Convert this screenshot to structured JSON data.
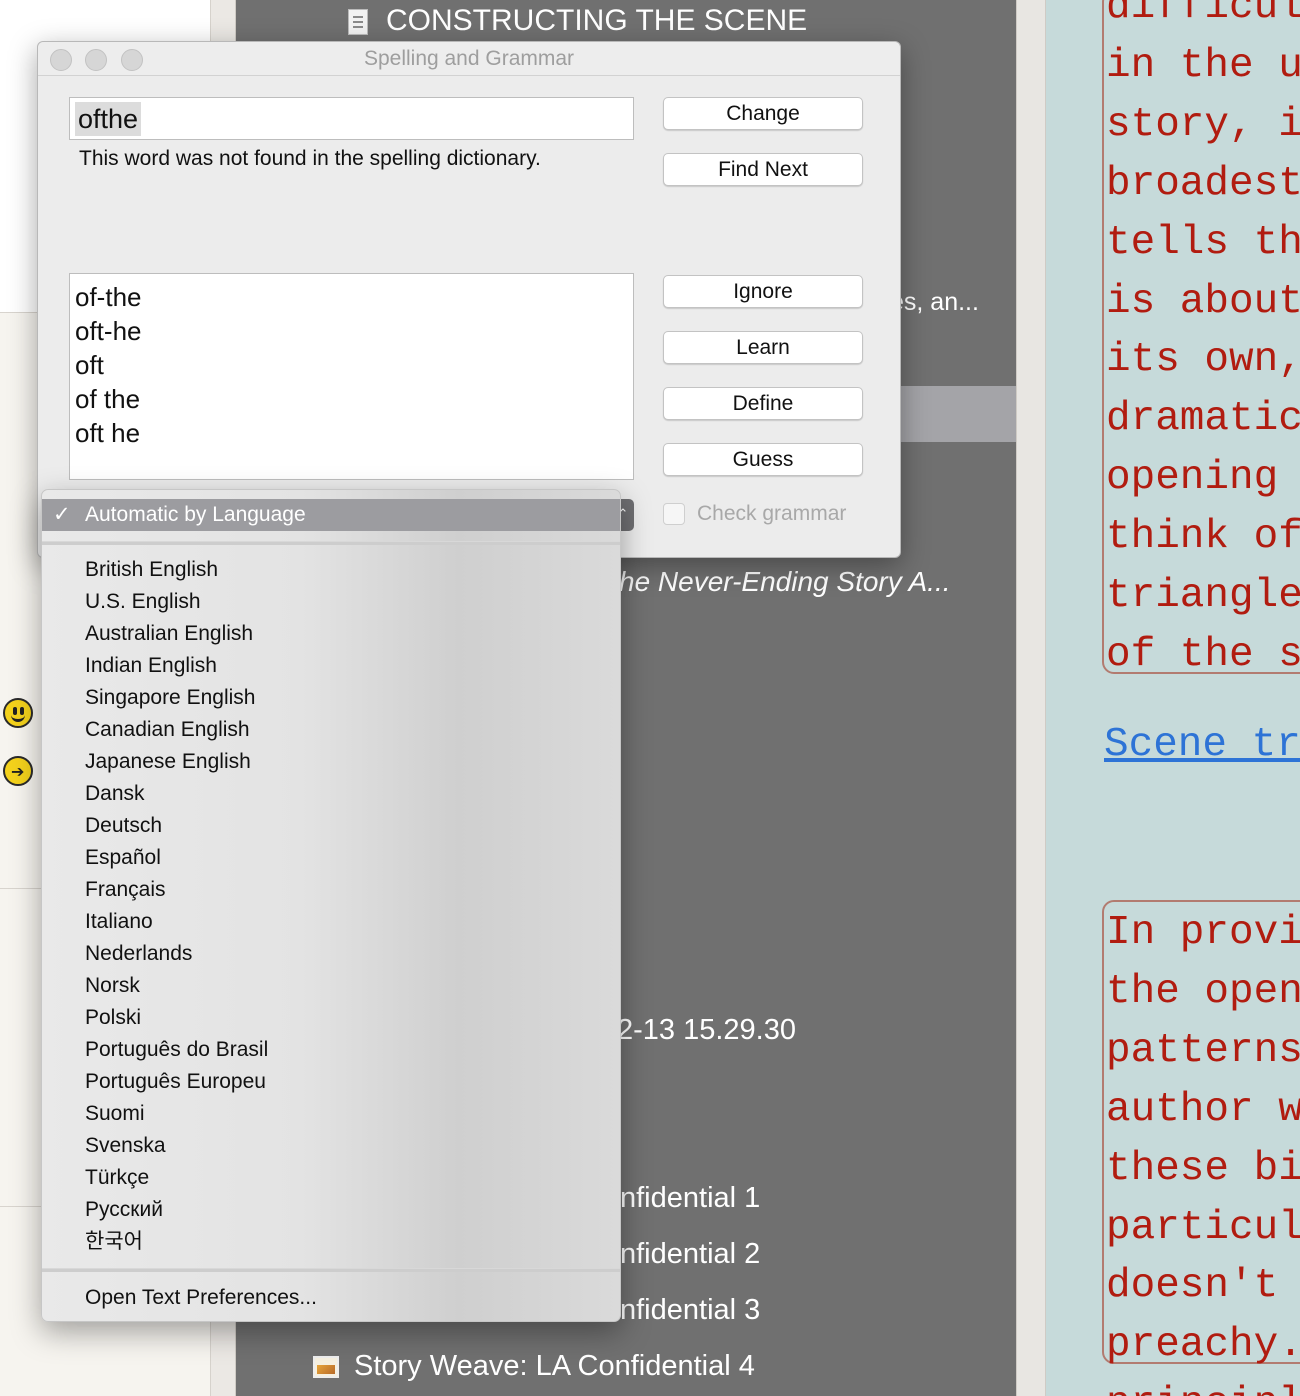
{
  "window": {
    "title": "Spelling and Grammar",
    "misspelled_word": "ofthe",
    "message": "This word was not found in the spelling dictionary.",
    "buttons": {
      "change": "Change",
      "find_next": "Find Next",
      "ignore": "Ignore",
      "learn": "Learn",
      "define": "Define",
      "guess": "Guess"
    },
    "check_grammar_label": "Check grammar",
    "guesses": [
      "of-the",
      "oft-he",
      "oft",
      "of the",
      "oft he"
    ]
  },
  "language_menu": {
    "selected": "Automatic by Language",
    "checkmark": "✓",
    "languages": [
      "British English",
      "U.S. English",
      "Australian English",
      "Indian English",
      "Singapore English",
      "Canadian English",
      "Japanese English",
      "Dansk",
      "Deutsch",
      "Español",
      "Français",
      "Italiano",
      "Nederlands",
      "Norsk",
      "Polski",
      "Português do Brasil",
      "Português Europeu",
      "Suomi",
      "Svenska",
      "Türkçe",
      "Русский",
      "한국어"
    ],
    "open_prefs": "Open Text Preferences..."
  },
  "binder": {
    "title": "CONSTRUCTING THE SCENE",
    "partial_1": "es, an...",
    "partial_2": "he Never-Ending Story  A...",
    "partial_3": "2-13 15.29.30",
    "partial_4": "nfidential 1",
    "partial_5": "nfidential 2",
    "partial_6": "nfidential 3",
    "item_full": "Story Weave: LA Confidential 4"
  },
  "editor": {
    "lines_block_1": [
      "difficul",
      "in the u",
      "story, i",
      "broadest",
      "tells th",
      "is about",
      "its own,",
      "dramatic",
      "opening ",
      "think of",
      "triangle",
      "of the s"
    ],
    "link": "Scene tr",
    "lines_block_2": [
      "In provi",
      "the open",
      "patterns",
      "author w",
      "these bi",
      "particul",
      "doesn't ",
      "preachy.",
      "principl"
    ]
  },
  "icons": {
    "emoji_1": "smiley-face-icon",
    "emoji_2": "arrow-right-circle-icon",
    "doc": "document-icon",
    "image": "image-icon"
  },
  "colors": {
    "binder_bg": "#707070",
    "editor_bg": "#c6dada",
    "editor_text": "#b11c10",
    "link": "#2d73d6",
    "menu_highlight": "#9c9ca0"
  }
}
